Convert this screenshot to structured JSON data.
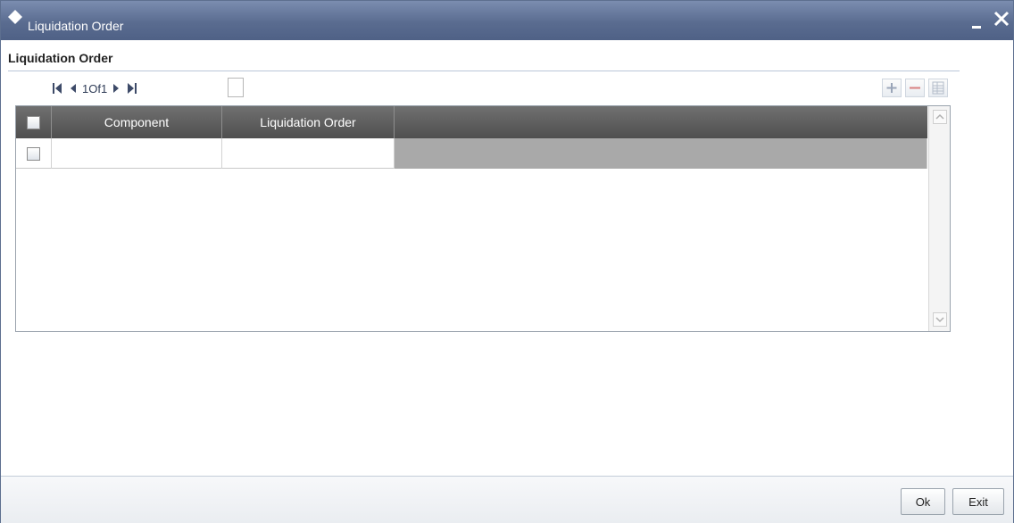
{
  "window": {
    "title": "Liquidation Order",
    "minimize_icon": "minimize-icon",
    "close_icon": "close-icon"
  },
  "section": {
    "label": "Liquidation Order"
  },
  "pager": {
    "text": "1Of1",
    "first_icon": "first-page-icon",
    "prev_icon": "prev-page-icon",
    "next_icon": "next-page-icon",
    "last_icon": "last-page-icon"
  },
  "toolbar": {
    "add_icon": "plus-icon",
    "delete_icon": "minus-icon",
    "columns_icon": "list-columns-icon"
  },
  "grid": {
    "columns": [
      "",
      "Component",
      "Liquidation Order"
    ],
    "rows": [
      {
        "component": "",
        "liquidation_order": ""
      }
    ]
  },
  "footer": {
    "ok_label": "Ok",
    "exit_label": "Exit"
  },
  "colors": {
    "titlebar": "#5a6c90",
    "header": "#5c5c5c",
    "row_fill": "#a9a9a9"
  }
}
